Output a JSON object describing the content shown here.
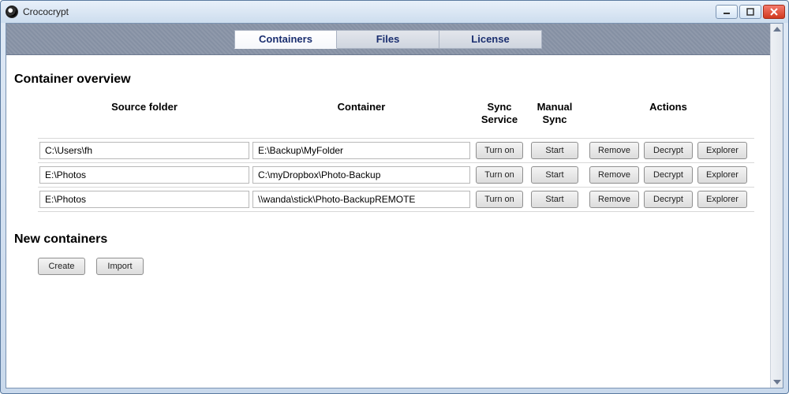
{
  "window": {
    "title": "Crococrypt"
  },
  "tabs": {
    "containers": "Containers",
    "files": "Files",
    "license": "License",
    "active": "containers"
  },
  "sections": {
    "overview_title": "Container overview",
    "new_title": "New containers"
  },
  "columns": {
    "source": "Source folder",
    "container": "Container",
    "sync_service": "Sync Service",
    "manual_sync": "Manual Sync",
    "actions": "Actions"
  },
  "buttons": {
    "turn_on": "Turn on",
    "start": "Start",
    "remove": "Remove",
    "decrypt": "Decrypt",
    "explorer": "Explorer",
    "create": "Create",
    "import": "Import"
  },
  "rows": [
    {
      "source": "C:\\Users\\fh",
      "container": "E:\\Backup\\MyFolder"
    },
    {
      "source": "E:\\Photos",
      "container": "C:\\myDropbox\\Photo-Backup"
    },
    {
      "source": "E:\\Photos",
      "container": "\\\\wanda\\stick\\Photo-BackupREMOTE"
    }
  ]
}
